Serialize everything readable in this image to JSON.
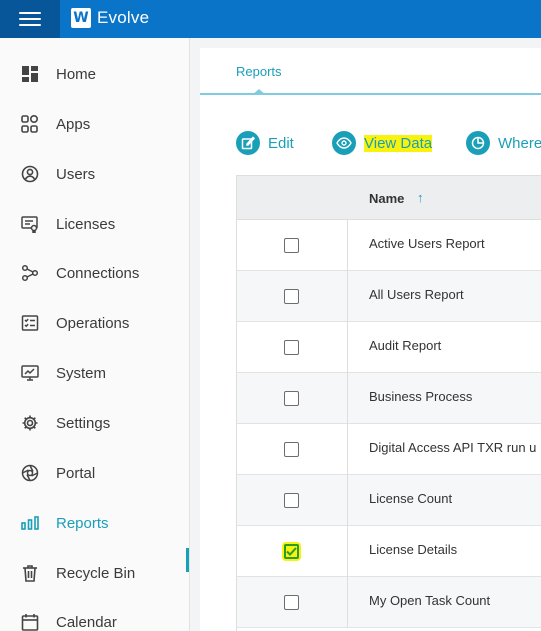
{
  "app": {
    "name": "Evolve",
    "logo_letter": "W"
  },
  "colors": {
    "topbar": "#0a74c9",
    "accent": "#1a9fb8",
    "highlight": "#f8f20f"
  },
  "sidebar": {
    "items": [
      {
        "label": "Home",
        "icon": "home-icon"
      },
      {
        "label": "Apps",
        "icon": "apps-icon"
      },
      {
        "label": "Users",
        "icon": "users-icon"
      },
      {
        "label": "Licenses",
        "icon": "licenses-icon"
      },
      {
        "label": "Connections",
        "icon": "connections-icon"
      },
      {
        "label": "Operations",
        "icon": "operations-icon"
      },
      {
        "label": "System",
        "icon": "system-icon"
      },
      {
        "label": "Settings",
        "icon": "gear-icon"
      },
      {
        "label": "Portal",
        "icon": "portal-icon"
      },
      {
        "label": "Reports",
        "icon": "reports-icon",
        "active": true
      },
      {
        "label": "Recycle Bin",
        "icon": "trash-icon"
      },
      {
        "label": "Calendar",
        "icon": "calendar-icon"
      }
    ]
  },
  "main": {
    "tabs": [
      {
        "label": "Reports",
        "active": true
      }
    ],
    "toolbar": {
      "edit": "Edit",
      "view_data": "View Data",
      "where": "Where"
    },
    "table": {
      "header": {
        "name": "Name",
        "sort": "↑"
      },
      "rows": [
        {
          "name": "Active Users Report",
          "checked": false
        },
        {
          "name": "All Users Report",
          "checked": false
        },
        {
          "name": "Audit Report",
          "checked": false
        },
        {
          "name": "Business Process",
          "checked": false
        },
        {
          "name": "Digital Access API TXR run u",
          "checked": false
        },
        {
          "name": "License Count",
          "checked": false
        },
        {
          "name": "License Details",
          "checked": true
        },
        {
          "name": "My Open Task Count",
          "checked": false
        }
      ]
    }
  }
}
